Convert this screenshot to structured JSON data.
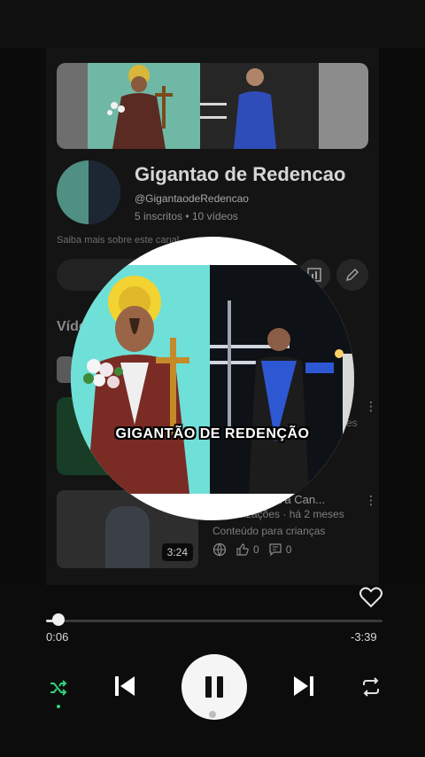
{
  "channel": {
    "name": "Gigantao de Redencao",
    "handle": "@GigantaodeRedencao",
    "stats": "5 inscritos • 10 vídeos",
    "about": "Saiba mais sobre este canal"
  },
  "tabs": {
    "videos_label": "Víde"
  },
  "videos": [
    {
      "title": "...eza a Can...",
      "meta": "...alizações · há 2 meses",
      "kids_label": "Conteúdo para crianças",
      "likes": "0",
      "comments": "0",
      "duration": "3:24"
    }
  ],
  "side_text": "es",
  "artwork": {
    "caption": "GIGANTÃO DE REDENÇÃO"
  },
  "player": {
    "elapsed": "0:06",
    "remaining": "-3:39",
    "progress": 0.027
  },
  "colors": {
    "accent_green": "#2fd37b",
    "background": "#0b0b0b"
  }
}
